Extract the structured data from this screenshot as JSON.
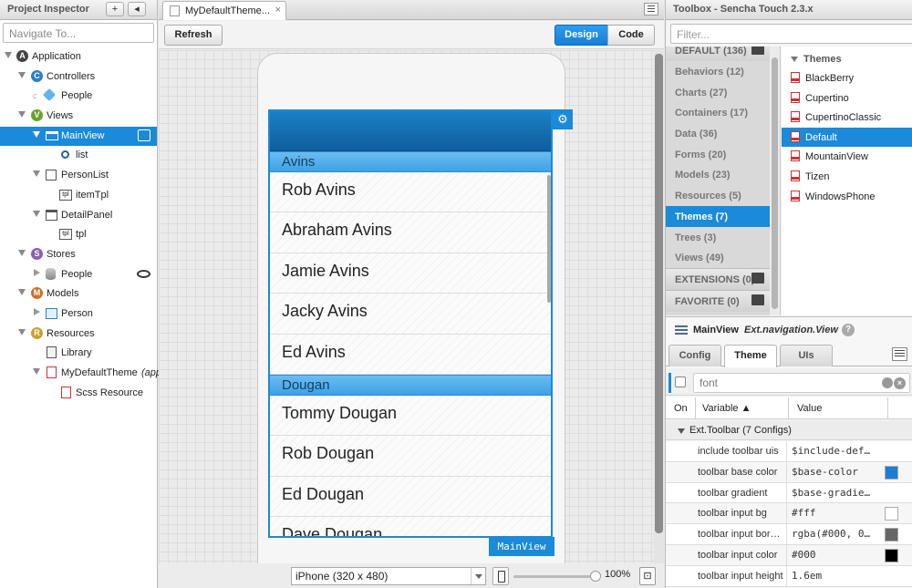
{
  "project_inspector": {
    "title": "Project Inspector",
    "add_label": "+",
    "back_label": "◂",
    "search_placeholder": "Navigate To...",
    "tree": [
      {
        "label": "Application",
        "icon": "A",
        "icon_color": "#444444"
      },
      {
        "label": "Controllers",
        "icon": "C",
        "icon_color": "#2a7fc8"
      },
      {
        "label": "People"
      },
      {
        "label": "Views",
        "icon": "V",
        "icon_color": "#6aa22c"
      },
      {
        "label": "MainView"
      },
      {
        "label": "list"
      },
      {
        "label": "PersonList"
      },
      {
        "label": "itemTpl",
        "tag": "tpl"
      },
      {
        "label": "DetailPanel"
      },
      {
        "label": "tpl",
        "tag": "tpl"
      },
      {
        "label": "Stores",
        "icon": "S",
        "icon_color": "#8a5fb5"
      },
      {
        "label": "People"
      },
      {
        "label": "Models",
        "icon": "M",
        "icon_color": "#c9722d"
      },
      {
        "label": "Person"
      },
      {
        "label": "Resources",
        "icon": "R",
        "icon_color": "#c9a22d"
      },
      {
        "label": "Library"
      },
      {
        "label": "MyDefaultTheme",
        "suffix": "(app"
      },
      {
        "label": "Scss Resource"
      }
    ]
  },
  "canvas": {
    "tab_title": "MyDefaultTheme...",
    "tab_close": "×",
    "refresh_label": "Refresh",
    "design_label": "Design",
    "code_label": "Code",
    "groups": [
      {
        "header": "Avins",
        "items": [
          "Rob Avins",
          "Abraham Avins",
          "Jamie Avins",
          "Jacky Avins",
          "Ed Avins"
        ]
      },
      {
        "header": "Dougan",
        "items": [
          "Tommy Dougan",
          "Rob Dougan",
          "Ed Dougan",
          "Dave Dougan"
        ]
      }
    ],
    "component_tag": "MainView",
    "gear_icon": "⚙",
    "device_select": "iPhone (320 x 480)",
    "zoom_level": "100%",
    "fit_icon": "⊡",
    "zoom_fraction": 1.0
  },
  "toolbox": {
    "title": "Toolbox - Sencha Touch 2.3.x",
    "filter_placeholder": "Filter...",
    "categories": [
      {
        "label": "DEFAULT (136)",
        "type": "section"
      },
      {
        "label": "Behaviors (12)"
      },
      {
        "label": "Charts (27)"
      },
      {
        "label": "Containers (17)"
      },
      {
        "label": "Data (36)"
      },
      {
        "label": "Forms (20)"
      },
      {
        "label": "Models (23)"
      },
      {
        "label": "Resources (5)"
      },
      {
        "label": "Themes (7)",
        "selected": true
      },
      {
        "label": "Trees (3)"
      },
      {
        "label": "Views (49)"
      },
      {
        "label": "EXTENSIONS (0)",
        "type": "section"
      },
      {
        "label": "FAVORITE (0)",
        "type": "section"
      }
    ],
    "themes_header": "Themes",
    "themes": [
      "BlackBerry",
      "Cupertino",
      "CupertinoClassic",
      "Default",
      "MountainView",
      "Tizen",
      "WindowsPhone"
    ],
    "selected_theme": "Default"
  },
  "config_inspector": {
    "component_name": "MainView",
    "component_class": "Ext.navigation.View",
    "help_icon": "?",
    "tabs": [
      "Config",
      "Theme",
      "UIs"
    ],
    "active_tab": "Theme",
    "search_value": "font",
    "columns": {
      "on": "On",
      "variable": "Variable ▲",
      "value": "Value"
    },
    "group_label": "Ext.Toolbar (7 Configs)",
    "rows": [
      {
        "name": "include toolbar uis",
        "value": "$include-def…",
        "swatch": ""
      },
      {
        "name": "toolbar base color",
        "value": "$base-color",
        "swatch": "#1a7fd4"
      },
      {
        "name": "toolbar gradient",
        "value": "$base-gradie…",
        "swatch": ""
      },
      {
        "name": "toolbar input bg",
        "value": "#fff",
        "swatch": "#ffffff"
      },
      {
        "name": "toolbar input bor…",
        "value": "rgba(#000, 0…",
        "swatch": "#666666"
      },
      {
        "name": "toolbar input color",
        "value": "#000",
        "swatch": "#000000"
      },
      {
        "name": "toolbar input height",
        "value": "1.6em",
        "swatch": ""
      }
    ]
  }
}
